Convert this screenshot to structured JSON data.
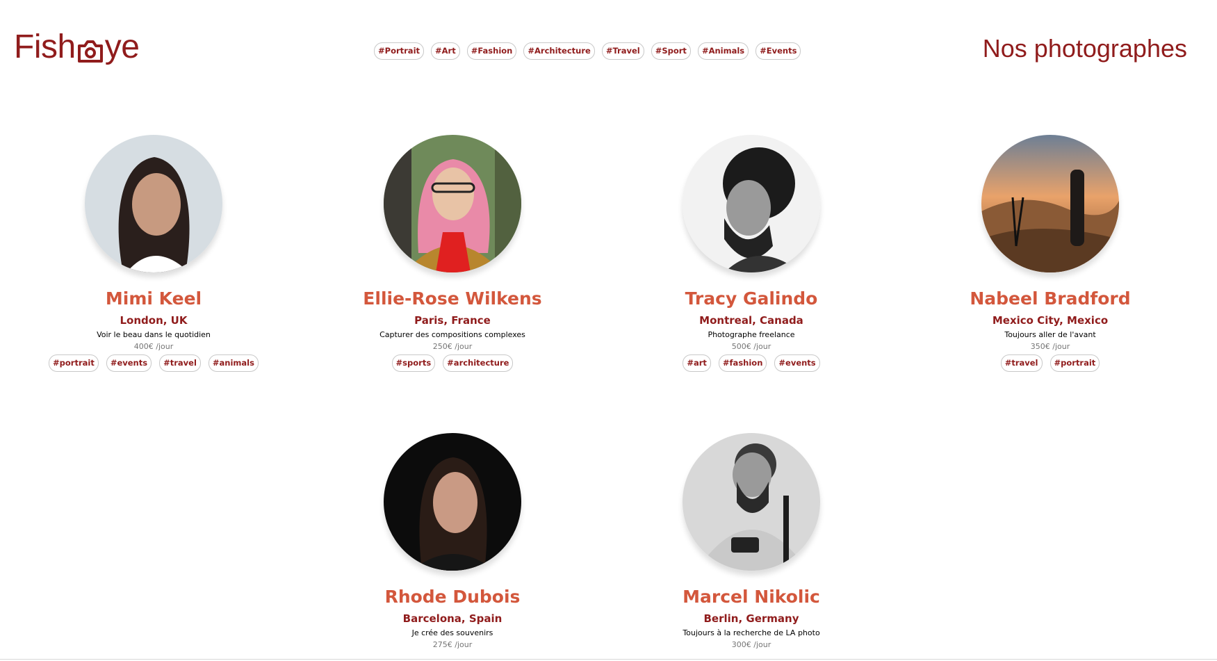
{
  "header": {
    "logo_text_left": "Fish",
    "logo_text_right": "ye",
    "page_title": "Nos photographes",
    "nav_tags": [
      "#Portrait",
      "#Art",
      "#Fashion",
      "#Architecture",
      "#Travel",
      "#Sport",
      "#Animals",
      "#Events"
    ]
  },
  "colors": {
    "brand": "#901c1c",
    "name_accent": "#d3573c",
    "price_gray": "#757575"
  },
  "photographers": [
    {
      "name": "Mimi Keel",
      "location": "London, UK",
      "tagline": "Voir le beau dans le quotidien",
      "price": "400€ /jour",
      "tags": [
        "#portrait",
        "#events",
        "#travel",
        "#animals"
      ],
      "portrait_icon": "portrait-photo"
    },
    {
      "name": "Ellie-Rose Wilkens",
      "location": "Paris, France",
      "tagline": "Capturer des compositions complexes",
      "price": "250€ /jour",
      "tags": [
        "#sports",
        "#architecture"
      ],
      "portrait_icon": "portrait-photo"
    },
    {
      "name": "Tracy Galindo",
      "location": "Montreal, Canada",
      "tagline": "Photographe freelance",
      "price": "500€ /jour",
      "tags": [
        "#art",
        "#fashion",
        "#events"
      ],
      "portrait_icon": "portrait-photo"
    },
    {
      "name": "Nabeel Bradford",
      "location": "Mexico City, Mexico",
      "tagline": "Toujours aller de l'avant",
      "price": "350€ /jour",
      "tags": [
        "#travel",
        "#portrait"
      ],
      "portrait_icon": "landscape-photo"
    },
    {
      "name": "Rhode Dubois",
      "location": "Barcelona, Spain",
      "tagline": "Je crée des souvenirs",
      "price": "275€ /jour",
      "tags": [],
      "portrait_icon": "portrait-photo"
    },
    {
      "name": "Marcel Nikolic",
      "location": "Berlin, Germany",
      "tagline": "Toujours à la recherche de LA photo",
      "price": "300€ /jour",
      "tags": [],
      "portrait_icon": "portrait-photo"
    }
  ]
}
